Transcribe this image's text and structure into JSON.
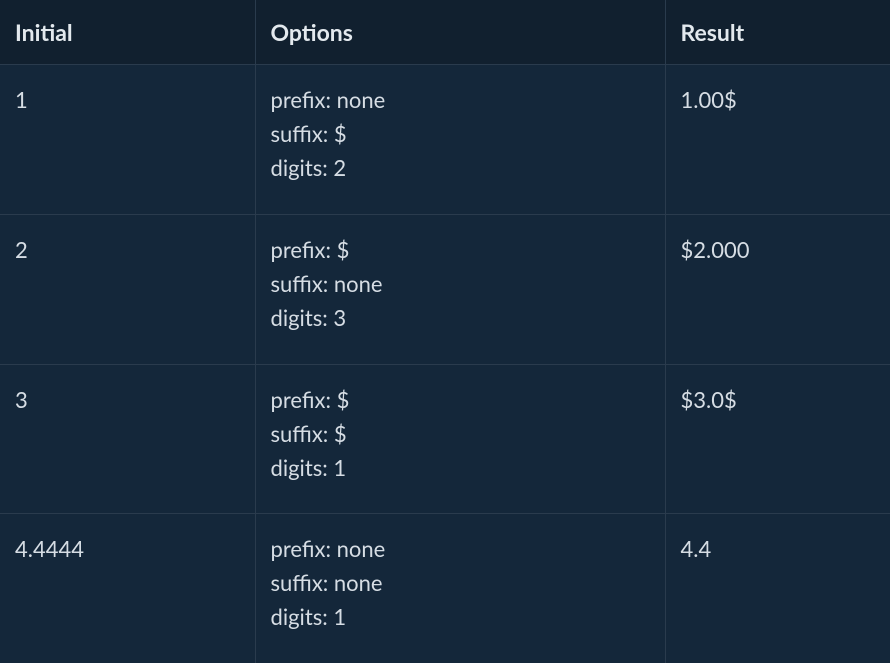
{
  "headers": {
    "initial": "Initial",
    "options": "Options",
    "result": "Result"
  },
  "rows": [
    {
      "initial": "1",
      "options": {
        "prefix": "prefix: none",
        "suffix": "suffix: $",
        "digits": "digits: 2"
      },
      "result": "1.00$"
    },
    {
      "initial": "2",
      "options": {
        "prefix": "prefix: $",
        "suffix": "suffix: none",
        "digits": "digits: 3"
      },
      "result": "$2.000"
    },
    {
      "initial": "3",
      "options": {
        "prefix": "prefix: $",
        "suffix": "suffix: $",
        "digits": "digits: 1"
      },
      "result": "$3.0$"
    },
    {
      "initial": "4.4444",
      "options": {
        "prefix": "prefix: none",
        "suffix": "suffix: none",
        "digits": "digits: 1"
      },
      "result": "4.4"
    }
  ]
}
